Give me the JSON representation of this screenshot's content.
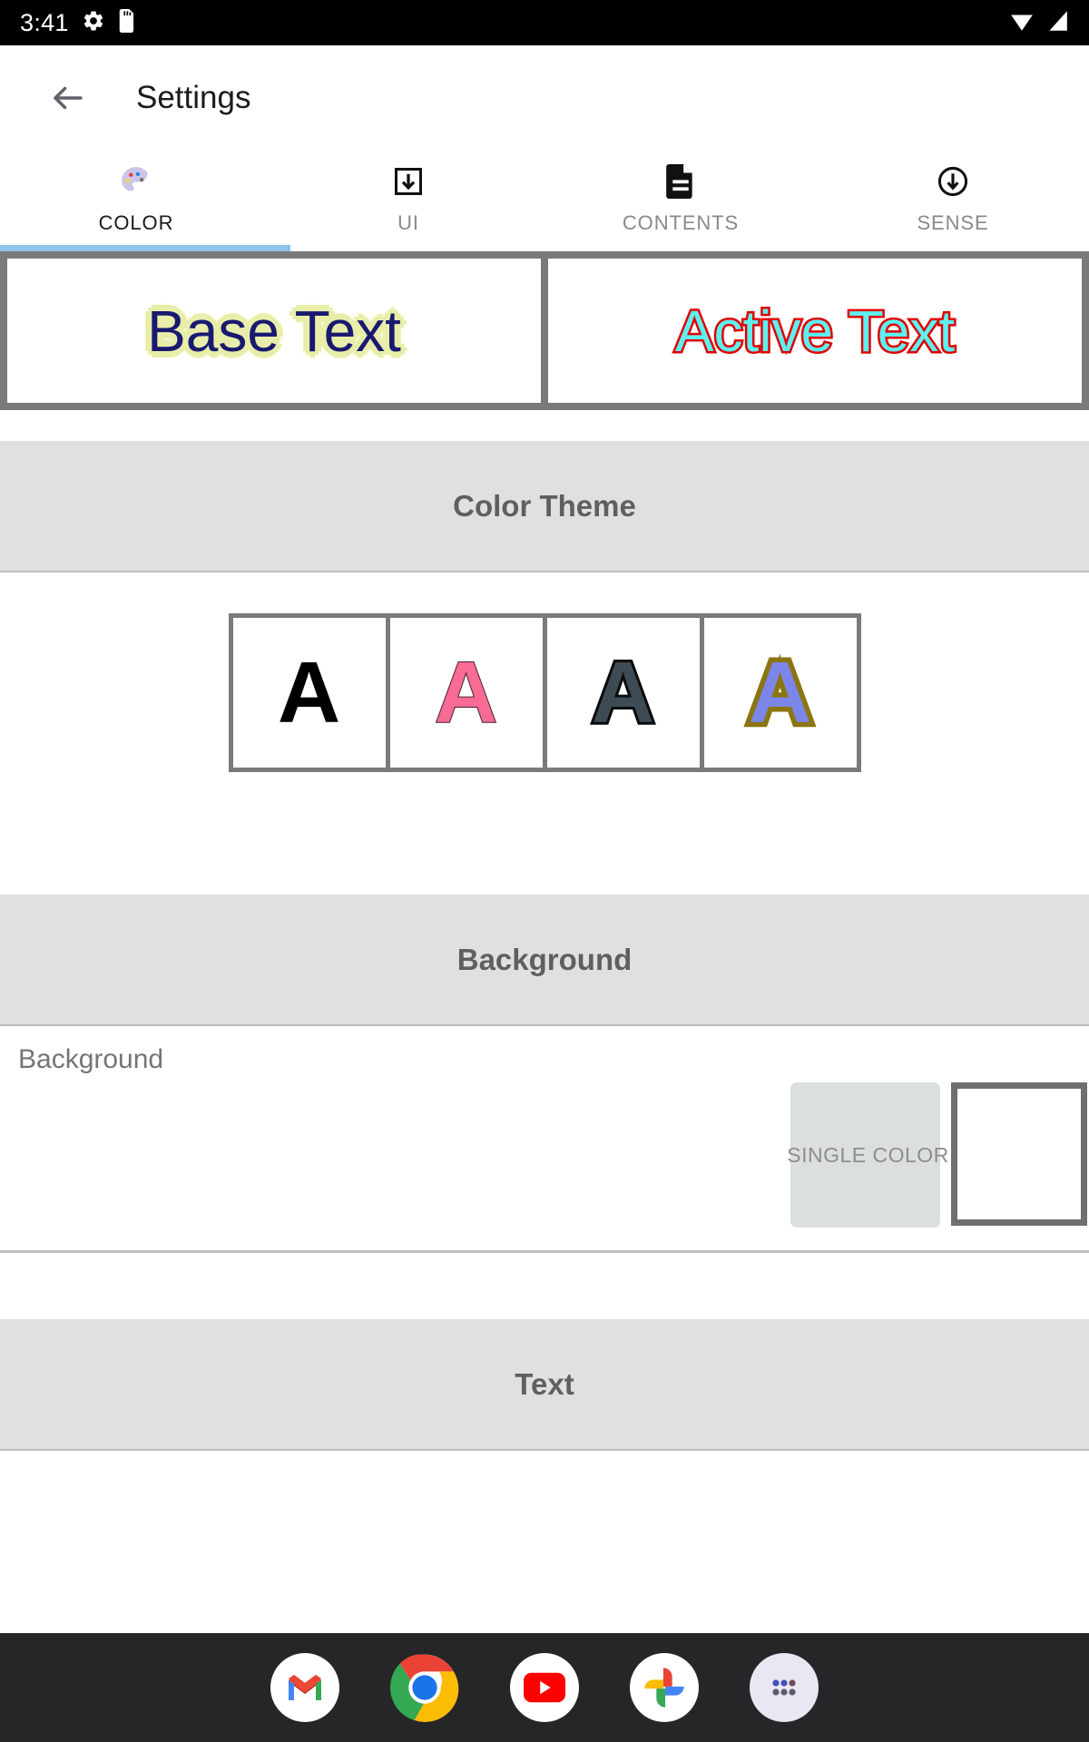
{
  "status_bar": {
    "time": "3:41",
    "icons": [
      "gear-icon",
      "sd-card-icon"
    ],
    "right_icons": [
      "wifi-icon",
      "signal-icon"
    ]
  },
  "app_bar": {
    "back_icon": "back-arrow-icon",
    "title": "Settings"
  },
  "tabs": [
    {
      "label": "COLOR",
      "icon": "palette-icon",
      "active": true
    },
    {
      "label": "UI",
      "icon": "download-box-icon",
      "active": false
    },
    {
      "label": "CONTENTS",
      "icon": "document-icon",
      "active": false
    },
    {
      "label": "SENSE",
      "icon": "circle-arrow-down-icon",
      "active": false
    }
  ],
  "preview": {
    "base": {
      "text": "Base Text",
      "color": "#191970",
      "glow": "#e8eeaa"
    },
    "active": {
      "text": "Active Text",
      "color": "#5ef0f0",
      "stroke": "#e00000"
    }
  },
  "sections": {
    "color_theme": "Color Theme",
    "background": "Background",
    "text": "Text"
  },
  "theme_swatches": [
    {
      "glyph": "A",
      "fill": "#000000",
      "stroke": "#000000"
    },
    {
      "glyph": "A",
      "fill": "#f76b94",
      "stroke": "#4a2030"
    },
    {
      "glyph": "A",
      "fill": "#3d4b55",
      "stroke": "#0b0b0b"
    },
    {
      "glyph": "A",
      "fill": "#7b86e8",
      "stroke": "#8b7510"
    }
  ],
  "background_row": {
    "label": "Background",
    "button_label": "SINGLE COLOR",
    "preview_color": "#ffffff"
  },
  "dock": {
    "apps": [
      "gmail-icon",
      "chrome-icon",
      "youtube-icon",
      "google-photos-icon",
      "app-drawer-icon"
    ]
  }
}
